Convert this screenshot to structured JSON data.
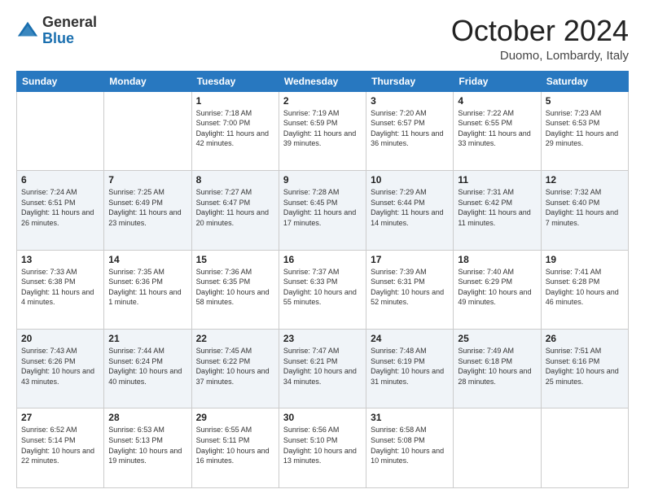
{
  "header": {
    "logo_general": "General",
    "logo_blue": "Blue",
    "month_title": "October 2024",
    "location": "Duomo, Lombardy, Italy"
  },
  "days_of_week": [
    "Sunday",
    "Monday",
    "Tuesday",
    "Wednesday",
    "Thursday",
    "Friday",
    "Saturday"
  ],
  "weeks": [
    [
      {
        "day": "",
        "info": ""
      },
      {
        "day": "",
        "info": ""
      },
      {
        "day": "1",
        "info": "Sunrise: 7:18 AM\nSunset: 7:00 PM\nDaylight: 11 hours and 42 minutes."
      },
      {
        "day": "2",
        "info": "Sunrise: 7:19 AM\nSunset: 6:59 PM\nDaylight: 11 hours and 39 minutes."
      },
      {
        "day": "3",
        "info": "Sunrise: 7:20 AM\nSunset: 6:57 PM\nDaylight: 11 hours and 36 minutes."
      },
      {
        "day": "4",
        "info": "Sunrise: 7:22 AM\nSunset: 6:55 PM\nDaylight: 11 hours and 33 minutes."
      },
      {
        "day": "5",
        "info": "Sunrise: 7:23 AM\nSunset: 6:53 PM\nDaylight: 11 hours and 29 minutes."
      }
    ],
    [
      {
        "day": "6",
        "info": "Sunrise: 7:24 AM\nSunset: 6:51 PM\nDaylight: 11 hours and 26 minutes."
      },
      {
        "day": "7",
        "info": "Sunrise: 7:25 AM\nSunset: 6:49 PM\nDaylight: 11 hours and 23 minutes."
      },
      {
        "day": "8",
        "info": "Sunrise: 7:27 AM\nSunset: 6:47 PM\nDaylight: 11 hours and 20 minutes."
      },
      {
        "day": "9",
        "info": "Sunrise: 7:28 AM\nSunset: 6:45 PM\nDaylight: 11 hours and 17 minutes."
      },
      {
        "day": "10",
        "info": "Sunrise: 7:29 AM\nSunset: 6:44 PM\nDaylight: 11 hours and 14 minutes."
      },
      {
        "day": "11",
        "info": "Sunrise: 7:31 AM\nSunset: 6:42 PM\nDaylight: 11 hours and 11 minutes."
      },
      {
        "day": "12",
        "info": "Sunrise: 7:32 AM\nSunset: 6:40 PM\nDaylight: 11 hours and 7 minutes."
      }
    ],
    [
      {
        "day": "13",
        "info": "Sunrise: 7:33 AM\nSunset: 6:38 PM\nDaylight: 11 hours and 4 minutes."
      },
      {
        "day": "14",
        "info": "Sunrise: 7:35 AM\nSunset: 6:36 PM\nDaylight: 11 hours and 1 minute."
      },
      {
        "day": "15",
        "info": "Sunrise: 7:36 AM\nSunset: 6:35 PM\nDaylight: 10 hours and 58 minutes."
      },
      {
        "day": "16",
        "info": "Sunrise: 7:37 AM\nSunset: 6:33 PM\nDaylight: 10 hours and 55 minutes."
      },
      {
        "day": "17",
        "info": "Sunrise: 7:39 AM\nSunset: 6:31 PM\nDaylight: 10 hours and 52 minutes."
      },
      {
        "day": "18",
        "info": "Sunrise: 7:40 AM\nSunset: 6:29 PM\nDaylight: 10 hours and 49 minutes."
      },
      {
        "day": "19",
        "info": "Sunrise: 7:41 AM\nSunset: 6:28 PM\nDaylight: 10 hours and 46 minutes."
      }
    ],
    [
      {
        "day": "20",
        "info": "Sunrise: 7:43 AM\nSunset: 6:26 PM\nDaylight: 10 hours and 43 minutes."
      },
      {
        "day": "21",
        "info": "Sunrise: 7:44 AM\nSunset: 6:24 PM\nDaylight: 10 hours and 40 minutes."
      },
      {
        "day": "22",
        "info": "Sunrise: 7:45 AM\nSunset: 6:22 PM\nDaylight: 10 hours and 37 minutes."
      },
      {
        "day": "23",
        "info": "Sunrise: 7:47 AM\nSunset: 6:21 PM\nDaylight: 10 hours and 34 minutes."
      },
      {
        "day": "24",
        "info": "Sunrise: 7:48 AM\nSunset: 6:19 PM\nDaylight: 10 hours and 31 minutes."
      },
      {
        "day": "25",
        "info": "Sunrise: 7:49 AM\nSunset: 6:18 PM\nDaylight: 10 hours and 28 minutes."
      },
      {
        "day": "26",
        "info": "Sunrise: 7:51 AM\nSunset: 6:16 PM\nDaylight: 10 hours and 25 minutes."
      }
    ],
    [
      {
        "day": "27",
        "info": "Sunrise: 6:52 AM\nSunset: 5:14 PM\nDaylight: 10 hours and 22 minutes."
      },
      {
        "day": "28",
        "info": "Sunrise: 6:53 AM\nSunset: 5:13 PM\nDaylight: 10 hours and 19 minutes."
      },
      {
        "day": "29",
        "info": "Sunrise: 6:55 AM\nSunset: 5:11 PM\nDaylight: 10 hours and 16 minutes."
      },
      {
        "day": "30",
        "info": "Sunrise: 6:56 AM\nSunset: 5:10 PM\nDaylight: 10 hours and 13 minutes."
      },
      {
        "day": "31",
        "info": "Sunrise: 6:58 AM\nSunset: 5:08 PM\nDaylight: 10 hours and 10 minutes."
      },
      {
        "day": "",
        "info": ""
      },
      {
        "day": "",
        "info": ""
      }
    ]
  ]
}
